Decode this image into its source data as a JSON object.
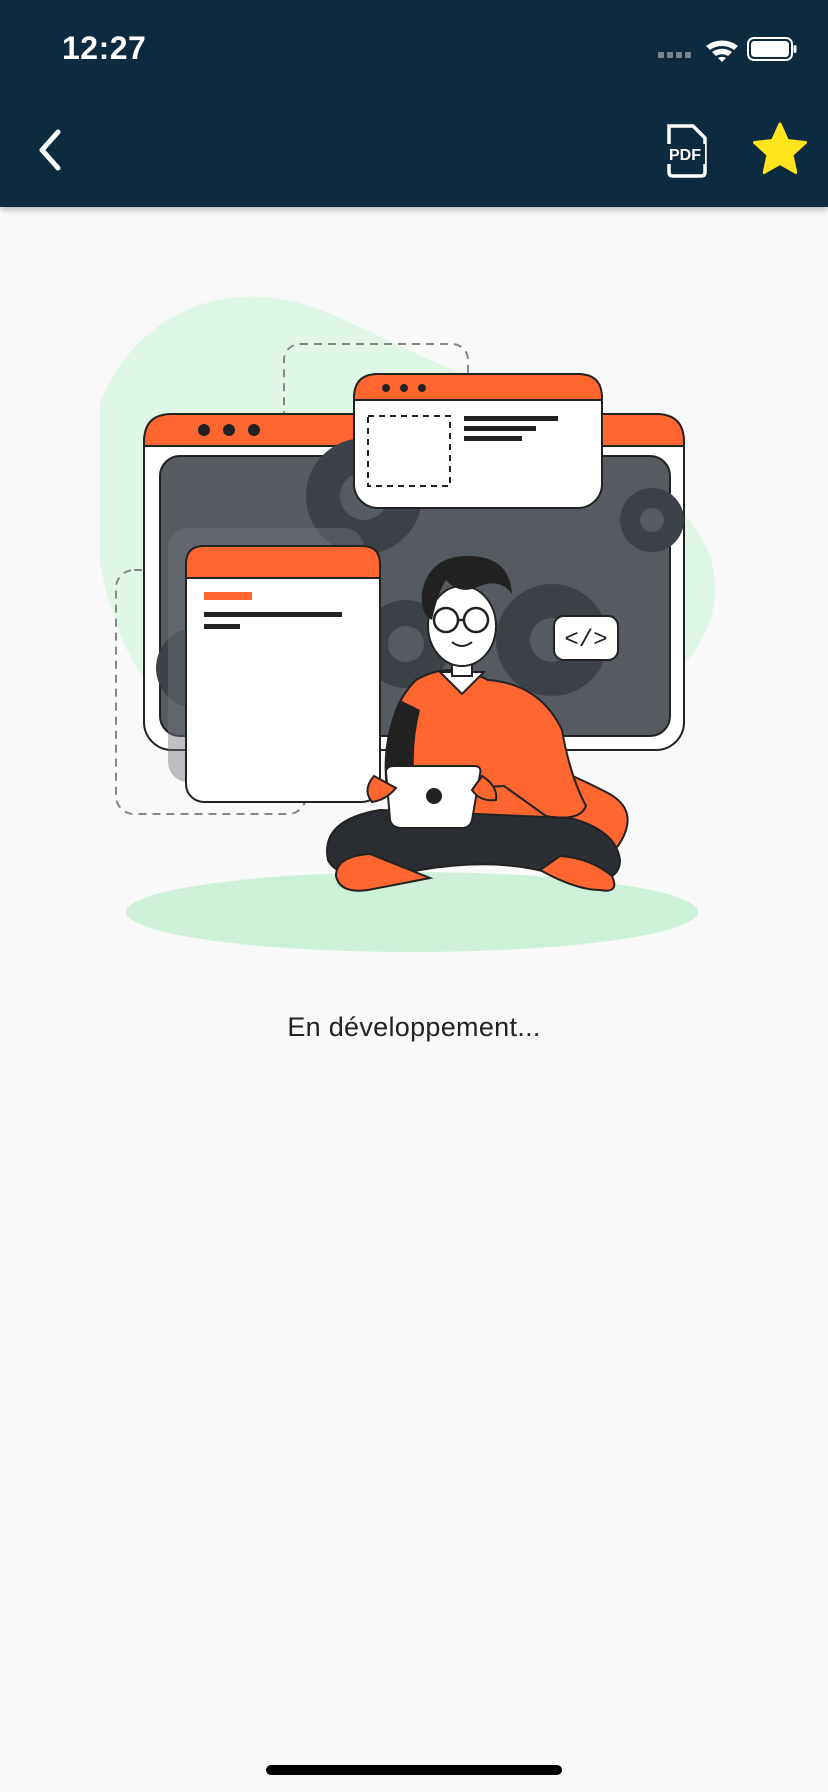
{
  "status_bar": {
    "time": "12:27",
    "icons": [
      "signal-icon",
      "wifi-icon",
      "battery-icon"
    ]
  },
  "header": {
    "back_icon": "chevron-left-icon",
    "pdf_icon": "pdf-file-icon",
    "pdf_icon_text": "PDF",
    "favorite_icon": "star-icon"
  },
  "illustration": {
    "code_tag": "</>"
  },
  "main": {
    "message": "En développement..."
  },
  "colors": {
    "header_bg": "#0c2a40",
    "accent_orange": "#ff6630",
    "blob_green": "#dff7e6",
    "star_yellow": "#ffe41c",
    "screen_gray": "#565b61",
    "background": "#f9f9f9"
  }
}
